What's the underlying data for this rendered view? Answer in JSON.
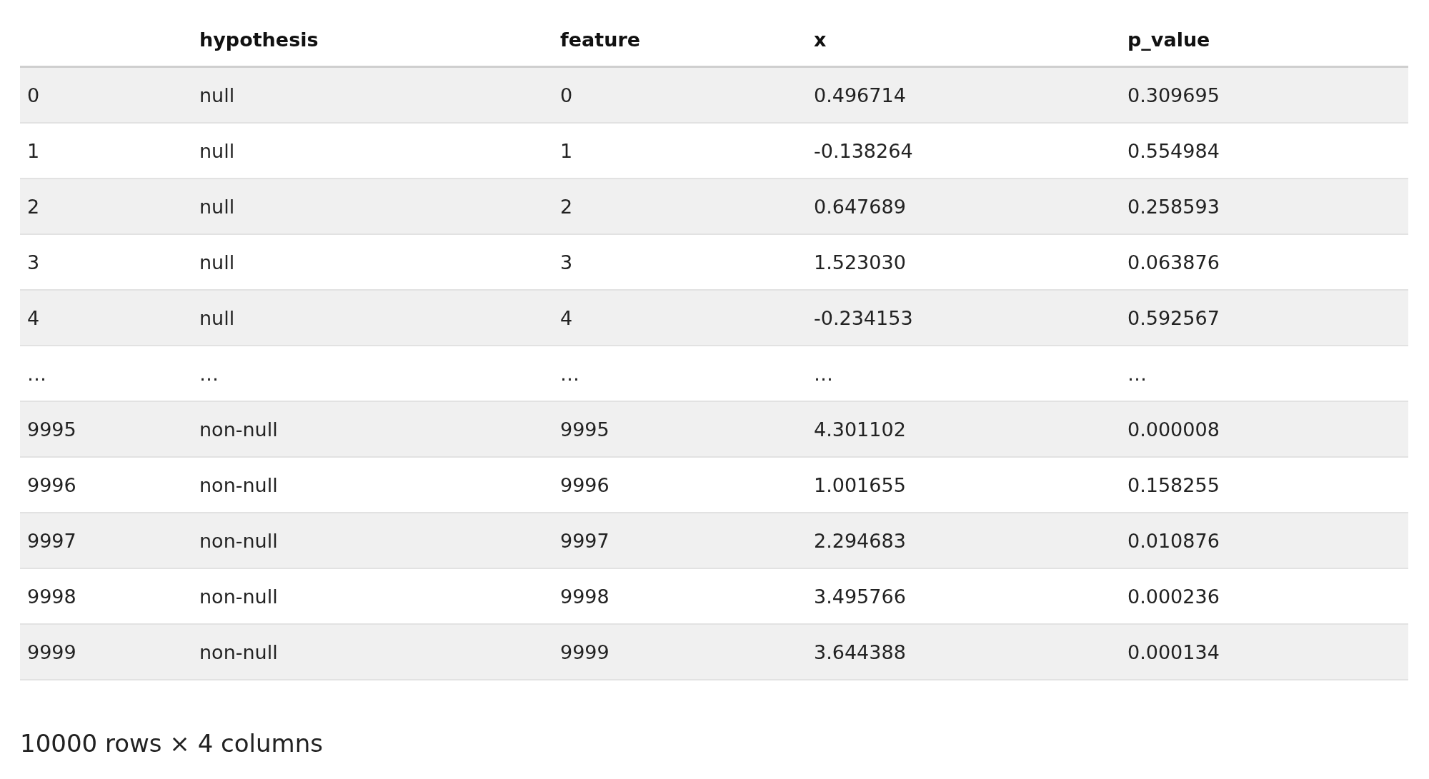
{
  "table": {
    "columns": [
      "hypothesis",
      "feature",
      "x",
      "p_value"
    ],
    "rows": [
      {
        "index": "0",
        "cells": [
          "null",
          "0",
          "0.496714",
          "0.309695"
        ]
      },
      {
        "index": "1",
        "cells": [
          "null",
          "1",
          "-0.138264",
          "0.554984"
        ]
      },
      {
        "index": "2",
        "cells": [
          "null",
          "2",
          "0.647689",
          "0.258593"
        ]
      },
      {
        "index": "3",
        "cells": [
          "null",
          "3",
          "1.523030",
          "0.063876"
        ]
      },
      {
        "index": "4",
        "cells": [
          "null",
          "4",
          "-0.234153",
          "0.592567"
        ]
      },
      {
        "index": "…",
        "cells": [
          "…",
          "…",
          "…",
          "…"
        ]
      },
      {
        "index": "9995",
        "cells": [
          "non-null",
          "9995",
          "4.301102",
          "0.000008"
        ]
      },
      {
        "index": "9996",
        "cells": [
          "non-null",
          "9996",
          "1.001655",
          "0.158255"
        ]
      },
      {
        "index": "9997",
        "cells": [
          "non-null",
          "9997",
          "2.294683",
          "0.010876"
        ]
      },
      {
        "index": "9998",
        "cells": [
          "non-null",
          "9998",
          "3.495766",
          "0.000236"
        ]
      },
      {
        "index": "9999",
        "cells": [
          "non-null",
          "9999",
          "3.644388",
          "0.000134"
        ]
      }
    ]
  },
  "footer": "10000 rows × 4 columns"
}
